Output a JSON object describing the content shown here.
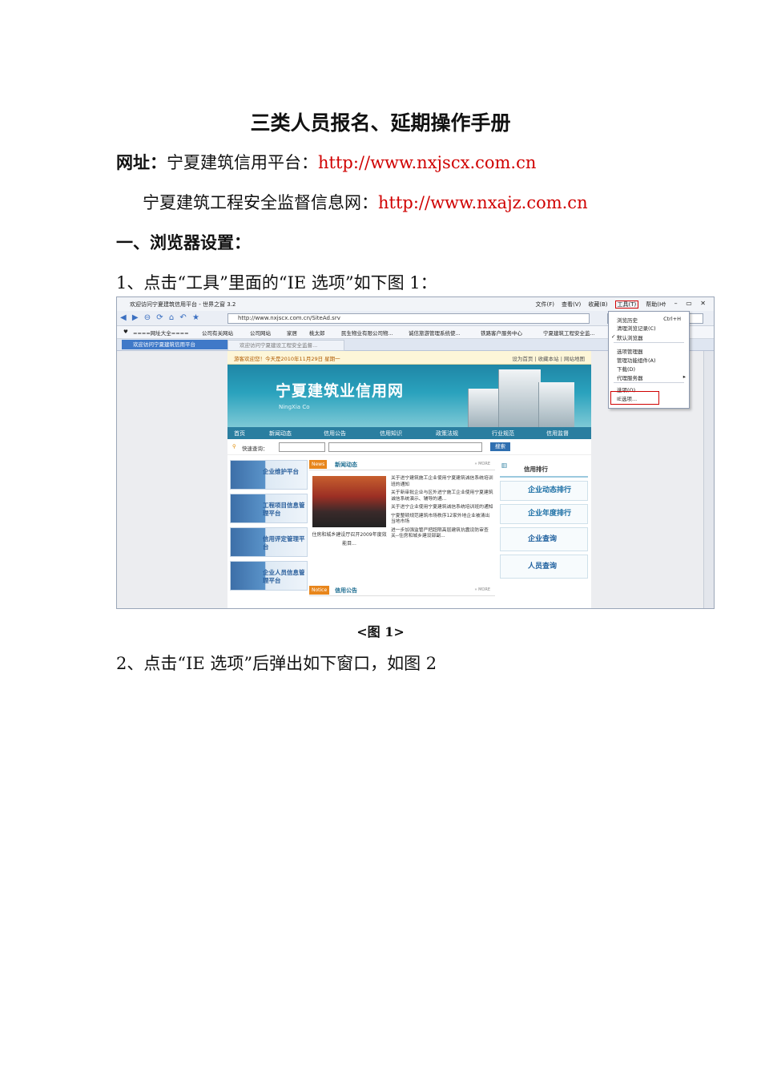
{
  "doc": {
    "title": "三类人员报名、延期操作手册",
    "url_line1_label": "网址：",
    "url_line1_site": "宁夏建筑信用平台：",
    "url_line1_url": "http://www.nxjscx.com.cn",
    "url_line2_site": "宁夏建筑工程安全监督信息网：",
    "url_line2_url": "http://www.nxajz.com.cn",
    "section1": "一、浏览器设置：",
    "step1": "1、点击“工具”里面的“IE 选项”如下图 1：",
    "caption1": "<图 1>",
    "step2": "2、点击“IE 选项”后弹出如下窗口，如图 2"
  },
  "screenshot": {
    "window_title": "欢迎访问宁夏建筑信用平台 - 世界之窗 3.2",
    "menus": [
      "文件(F)",
      "查看(V)",
      "收藏(B)",
      "工具(T)",
      "帮助(H)"
    ],
    "address": "http://www.nxjscx.com.cn/SiteAd.srv",
    "favorites": [
      "====网址大全====",
      "公司有关网站",
      "公司网站",
      "家居",
      "桃太郎",
      "民生物业有限公司物...",
      "诚信旅游管理系统使...",
      "铁路客户服务中心",
      "宁夏建筑工程安全监..."
    ],
    "tabs": [
      "欢迎访问宁夏建筑信用平台",
      "欢迎访问宁夏建设工程安全监督..."
    ],
    "tools_menu": {
      "items": [
        "浏览历史",
        "清理浏览记录(C)",
        "默认浏览器",
        "选项管理器",
        "管理功能组件(A)",
        "下载(D)",
        "代理服务器",
        "选项(O)",
        "IE选项..."
      ],
      "shortcut": "Ctrl+H"
    },
    "site": {
      "top_left": "游客欢迎您！今天是2010年11月29日 星期一",
      "top_right": "设为首页 | 收藏本站 | 网站地图",
      "banner_title": "宁夏建筑业信用网",
      "banner_sub": "NingXia Co",
      "nav": [
        "首页",
        "新闻动态",
        "信用公告",
        "信用知识",
        "政策法规",
        "行业规范",
        "信用监督"
      ],
      "search_label": "快速查询：",
      "search_button": "搜索",
      "left_boxes": [
        "企业维护平台",
        "工程项目信息管理平台",
        "信用评定管理平台",
        "企业人员信息管理平台"
      ],
      "news_badge": "News",
      "news_title": "新闻动态",
      "more": "» MORE",
      "photo_caption": "住房和城乡建设厅召开2009年度效能目...",
      "news_items": [
        "关于进宁建筑施工企业使用宁夏建筑诚信系统培训班的通知",
        "关于新审批企业与区外进宁施工企业使用宁夏建筑诚信系统演示、辅导的通...",
        "关于进宁企业使用宁夏建筑诚信系统培训班的通知",
        "宁夏整顿规范建筑市场秩序12家外地企业被清出当地市场",
        "进一步加强监管严把超限高层建筑抗震设防审查关--住房和城乡建设部副..."
      ],
      "notice_badge": "Notice",
      "notice_title": "信用公告",
      "right_head": "信用排行",
      "right_buttons": [
        "企业动态排行",
        "企业年度排行",
        "企业查询",
        "人员查询"
      ]
    }
  }
}
